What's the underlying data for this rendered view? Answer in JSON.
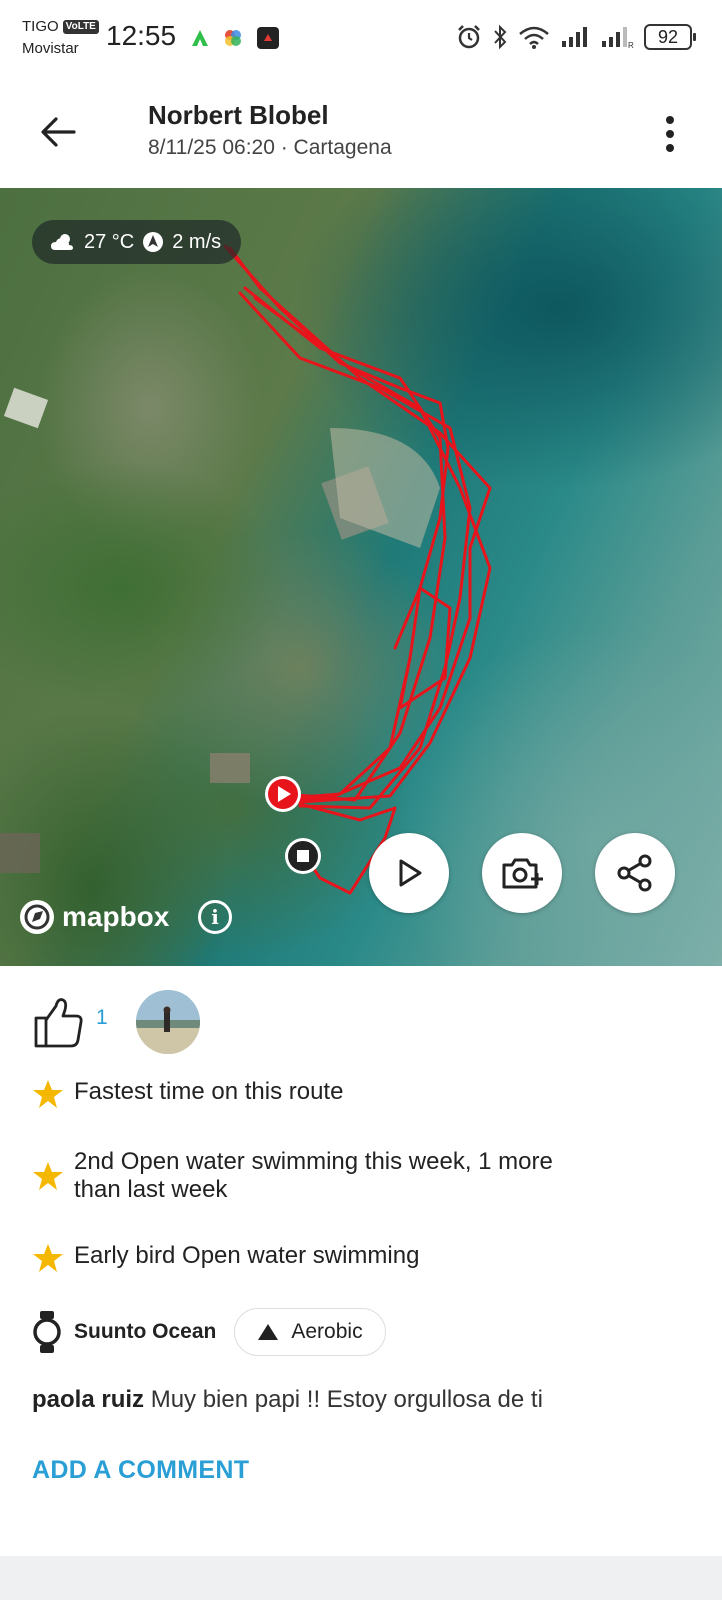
{
  "status_bar": {
    "carrier_line1": "TIGO",
    "volte": "VoLTE",
    "carrier_line2": "Movistar",
    "time": "12:55",
    "battery": "92"
  },
  "header": {
    "title": "Norbert Blobel",
    "subtitle": "8/11/25 06:20 · Cartagena"
  },
  "map": {
    "weather_temp": "27 °C",
    "weather_wind": "2 m/s",
    "attribution": "mapbox",
    "info_icon_label": "i",
    "route_color": "#e8141c"
  },
  "social": {
    "like_count": "1"
  },
  "achievements": [
    {
      "text": "Fastest time on this route"
    },
    {
      "text_line1": "2nd Open water swimming this week, 1 more",
      "text_line2": "than last week"
    },
    {
      "text": "Early bird Open water swimming"
    }
  ],
  "device": {
    "name": "Suunto Ocean",
    "training_effect": "Aerobic"
  },
  "comment": {
    "author": "paola ruiz",
    "text": "Muy bien papi !! Estoy orgullosa de ti"
  },
  "add_comment_label": "ADD A COMMENT",
  "colors": {
    "accent": "#2a9fd6",
    "star": "#f5b800",
    "route": "#e8141c"
  }
}
